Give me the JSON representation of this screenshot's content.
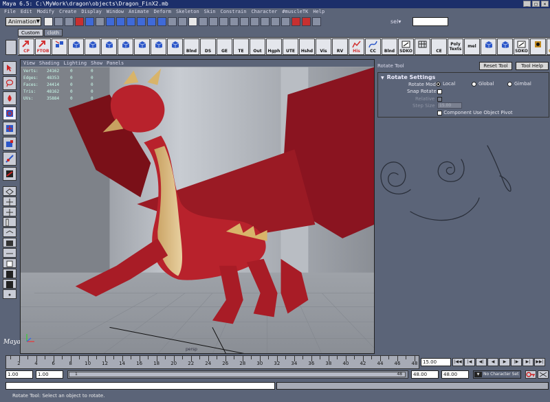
{
  "window": {
    "title": "Maya 6.5: C:\\MyWork\\dragon\\objects\\Dragon_FinX2.mb"
  },
  "menubar": {
    "items": [
      "File",
      "Edit",
      "Modify",
      "Create",
      "Display",
      "Window",
      "Animate",
      "Deform",
      "Skeleton",
      "Skin",
      "Constrain",
      "Character",
      "#muscleTK",
      "Help"
    ]
  },
  "statusline": {
    "mode": "Animation",
    "sel_label": "sel▾"
  },
  "shelf": {
    "tabs": [
      "Custom",
      "cloth"
    ],
    "buttons": [
      {
        "label": "CP",
        "icon": "arrow-icon",
        "color": "#d23030"
      },
      {
        "label": "FTOB",
        "icon": "arrow-icon",
        "color": "#d23030"
      },
      {
        "label": "",
        "icon": "cubes-icon",
        "color": "#2b56c8"
      },
      {
        "label": "",
        "icon": "cube-icon",
        "color": "#2b56c8"
      },
      {
        "label": "",
        "icon": "cube-icon",
        "color": "#2b56c8"
      },
      {
        "label": "",
        "icon": "cube-icon",
        "color": "#2b56c8"
      },
      {
        "label": "",
        "icon": "cube-icon",
        "color": "#2b56c8"
      },
      {
        "label": "",
        "icon": "cube-icon",
        "color": "#2b56c8"
      },
      {
        "label": "",
        "icon": "cube-icon",
        "color": "#2b56c8"
      },
      {
        "label": "",
        "icon": "cube-icon",
        "color": "#2b56c8"
      },
      {
        "label": "Blnd",
        "icon": "text"
      },
      {
        "label": "DS",
        "icon": "text"
      },
      {
        "label": "GE",
        "icon": "text"
      },
      {
        "label": "TE",
        "icon": "text"
      },
      {
        "label": "Out",
        "icon": "text"
      },
      {
        "label": "Hgph",
        "icon": "text"
      },
      {
        "label": "UTE",
        "icon": "text"
      },
      {
        "label": "Hshd",
        "icon": "text"
      },
      {
        "label": "Vis",
        "icon": "text"
      },
      {
        "label": "RV",
        "icon": "text"
      },
      {
        "label": "His",
        "icon": "graph-icon",
        "color": "#d23030"
      },
      {
        "label": "CC",
        "icon": "curve-icon",
        "color": "#2b56c8"
      },
      {
        "label": "Blnd",
        "icon": "text"
      },
      {
        "label": "SDKO",
        "icon": "key-icon",
        "color": "#222"
      },
      {
        "label": "",
        "icon": "grid-icon",
        "color": "#222"
      },
      {
        "label": "CE",
        "icon": "text"
      },
      {
        "label": "Poly Texts",
        "icon": "text"
      },
      {
        "label": "mel",
        "icon": "text"
      },
      {
        "label": "",
        "icon": "cube-icon",
        "color": "#2b56c8"
      },
      {
        "label": "",
        "icon": "cube-icon",
        "color": "#2b56c8"
      },
      {
        "label": "SDKO",
        "icon": "key-icon",
        "color": "#222"
      },
      {
        "label": "",
        "icon": "ctrl-icon",
        "color": "#c08a20"
      },
      {
        "label": "CTRL",
        "icon": "ctrl-icon",
        "color": "#c08a20"
      },
      {
        "label": "TOOL",
        "icon": "ctrl-icon",
        "color": "#c08a20"
      },
      {
        "label": "atte",
        "icon": "text"
      }
    ]
  },
  "viewport": {
    "menu": [
      "View",
      "Shading",
      "Lighting",
      "Show",
      "Panels"
    ],
    "hud": [
      {
        "label": "Verts:",
        "value": "24162",
        "sel": "0",
        "comp": "0"
      },
      {
        "label": "Edges:",
        "value": "48353",
        "sel": "0",
        "comp": "0"
      },
      {
        "label": "Faces:",
        "value": "24414",
        "sel": "0",
        "comp": "0"
      },
      {
        "label": "Tris:",
        "value": "48162",
        "sel": "0",
        "comp": "0"
      },
      {
        "label": "UVs:",
        "value": "35884",
        "sel": "0",
        "comp": "0"
      }
    ],
    "camera": "persp"
  },
  "tool_settings": {
    "title": "Rotate Tool",
    "reset_label": "Reset Tool",
    "help_label": "Tool Help",
    "frame_title": "Rotate Settings",
    "rotate_mode_label": "Rotate Mode",
    "modes": [
      "Local",
      "Global",
      "Gimbal"
    ],
    "selected_mode": "Local",
    "snap_rotate_label": "Snap Rotate",
    "relative_label": "Relative",
    "step_size_label": "Step Size",
    "step_size_value": "15.00",
    "component_pivot_label": "Component Use Object Pivot"
  },
  "timeline": {
    "ticks": [
      "2",
      "4",
      "6",
      "8",
      "10",
      "12",
      "14",
      "16",
      "18",
      "20",
      "22",
      "24",
      "26",
      "28",
      "30",
      "32",
      "34",
      "36",
      "38",
      "40",
      "42",
      "44",
      "46",
      "48"
    ],
    "current_time": "15.00",
    "playback": [
      "|◀◀",
      "|◀",
      "◀|",
      "◀",
      "▶",
      "|▶",
      "▶|",
      "▶▶|"
    ]
  },
  "range": {
    "start": "1.00",
    "start_range": "1.00",
    "handle_left": "1",
    "handle_right": "48",
    "end_range": "48.00",
    "end": "48.00",
    "character_set": "No Character Set"
  },
  "helpline": {
    "text": "Rotate Tool: Select an object to rotate."
  }
}
